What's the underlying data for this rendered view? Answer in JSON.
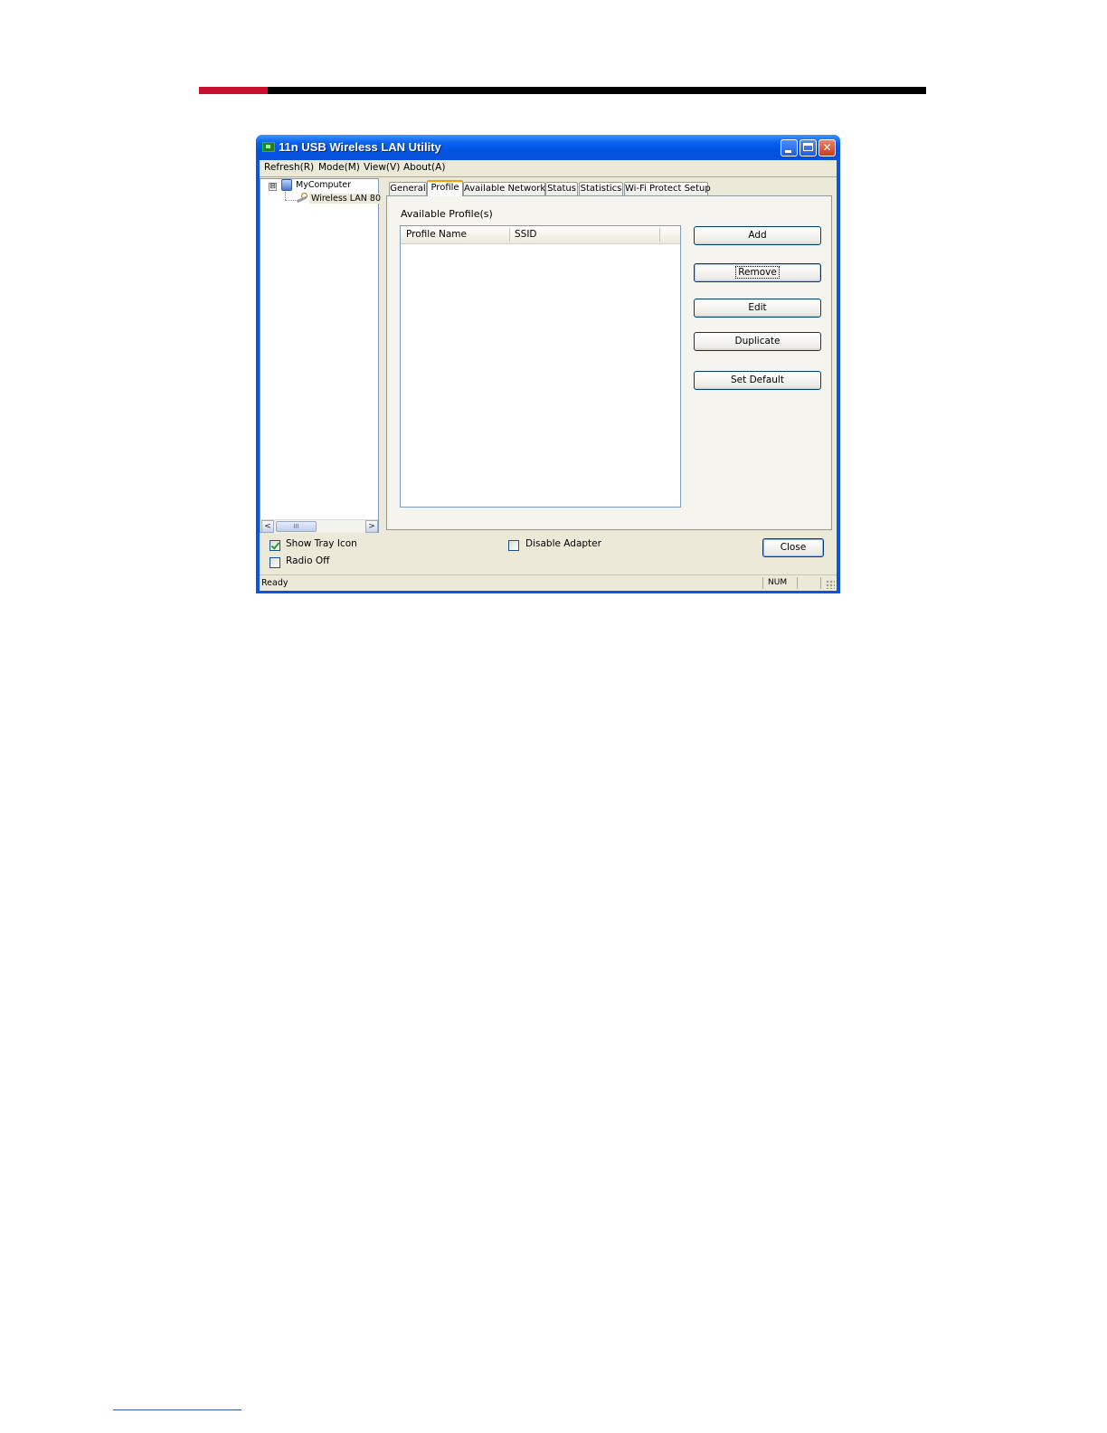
{
  "window": {
    "title": "11n USB Wireless LAN Utility",
    "controls": {
      "minimize": "",
      "maximize": "",
      "close": "✕"
    }
  },
  "menubar": [
    "Refresh(R)",
    "Mode(M)",
    "View(V)",
    "About(A)"
  ],
  "tree": {
    "expander": "⊟",
    "root": "MyComputer",
    "child": "Wireless LAN 80"
  },
  "scrollbar": {
    "left": "<",
    "right": ">",
    "thumb": "III"
  },
  "tabs": [
    "General",
    "Profile",
    "Available Network",
    "Status",
    "Statistics",
    "Wi-Fi Protect Setup"
  ],
  "active_tab": "Profile",
  "profile": {
    "heading": "Available Profile(s)",
    "columns": [
      "Profile Name",
      "SSID"
    ],
    "rows": [],
    "buttons": {
      "add": "Add",
      "remove": "Remove",
      "edit": "Edit",
      "duplicate": "Duplicate",
      "set_default": "Set Default"
    }
  },
  "options": {
    "show_tray_icon": {
      "label": "Show Tray Icon",
      "checked": true
    },
    "radio_off": {
      "label": "Radio Off",
      "checked": false
    },
    "disable_adapter": {
      "label": "Disable Adapter",
      "checked": false
    }
  },
  "close_label": "Close",
  "statusbar": {
    "text": "Ready",
    "num": "NUM"
  },
  "colors": {
    "title_blue": "#0054e3",
    "accent_tab": "#ff9a00",
    "header_red": "#c8102e"
  }
}
